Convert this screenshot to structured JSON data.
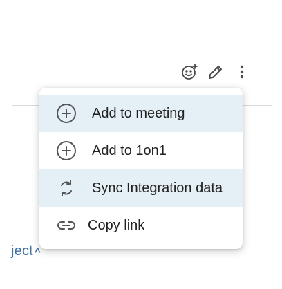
{
  "toolbar": {
    "icons": [
      "add-reaction-icon",
      "pencil-icon",
      "more-vertical-icon"
    ]
  },
  "background": {
    "link_text": "ject",
    "link_caret": "^"
  },
  "menu": {
    "items": [
      {
        "label": "Add to meeting",
        "icon": "plus-circle-icon",
        "highlighted": true
      },
      {
        "label": "Add to 1on1",
        "icon": "plus-circle-icon",
        "highlighted": false
      },
      {
        "label": "Sync Integration data",
        "icon": "sync-icon",
        "highlighted": true
      },
      {
        "label": "Copy link",
        "icon": "link-icon",
        "highlighted": false
      }
    ]
  },
  "colors": {
    "highlight": "#e4eff6",
    "link": "#3f6fa3",
    "text": "#222222"
  }
}
